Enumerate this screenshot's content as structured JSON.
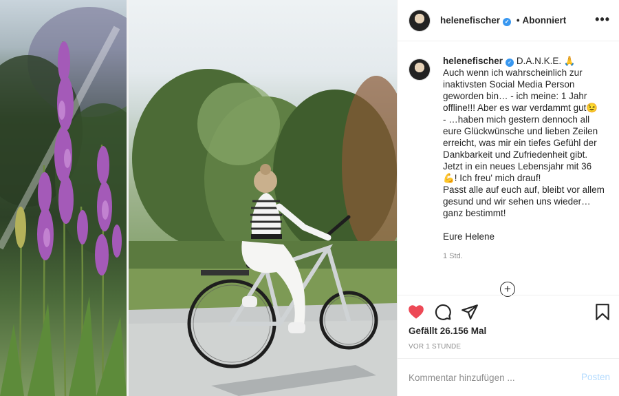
{
  "post": {
    "username": "helenefischer",
    "follow_state": "Abonniert",
    "more_label": "•••",
    "caption_lines": [
      "D.A.N.K.E. 🙏",
      "Auch wenn ich wahrscheinlich zur inaktivsten Social Media Person geworden bin… - ich meine: 1 Jahr offline!!! Aber es war verdammt gut😉",
      "- …haben mich gestern dennoch all eure Glückwünsche und lieben Zeilen erreicht, was mir ein tiefes Gefühl der Dankbarkeit und Zufriedenheit gibt.",
      "Jetzt in ein neues Lebensjahr mit 36 💪! Ich freu' mich drauf!",
      "Passt alle auf euch auf, bleibt vor allem gesund und wir sehen uns wieder…ganz bestimmt!"
    ],
    "caption_sign": "Eure Helene",
    "caption_time": "1 Std.",
    "likes": "Gefällt 26.156 Mal",
    "age": "VOR 1 STUNDE",
    "comment_placeholder": "Kommentar hinzufügen ...",
    "post_button": "Posten"
  },
  "icons": {
    "verified": "verified-badge-icon",
    "like": "heart-icon",
    "comment": "comment-bubble-icon",
    "share": "paper-plane-icon",
    "save": "bookmark-icon",
    "load_more": "plus-circle-icon"
  },
  "colors": {
    "like_red": "#ed4956",
    "verified_blue": "#3897f0",
    "post_button_disabled": "#b3dbff",
    "secondary_text": "#8e8e8e"
  }
}
